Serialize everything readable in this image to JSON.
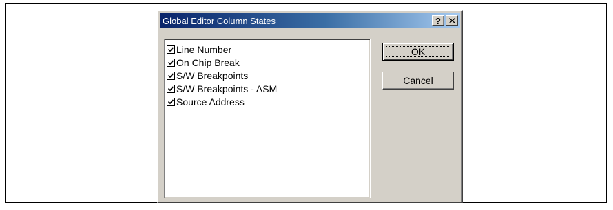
{
  "dialog": {
    "title": "Global Editor Column States",
    "help_button": "?",
    "close_button": "×"
  },
  "columns": [
    {
      "label": "Line Number",
      "checked": true
    },
    {
      "label": "On Chip Break",
      "checked": true
    },
    {
      "label": "S/W Breakpoints",
      "checked": true
    },
    {
      "label": "S/W Breakpoints - ASM",
      "checked": true
    },
    {
      "label": "Source Address",
      "checked": true
    }
  ],
  "buttons": {
    "ok": "OK",
    "cancel": "Cancel"
  }
}
